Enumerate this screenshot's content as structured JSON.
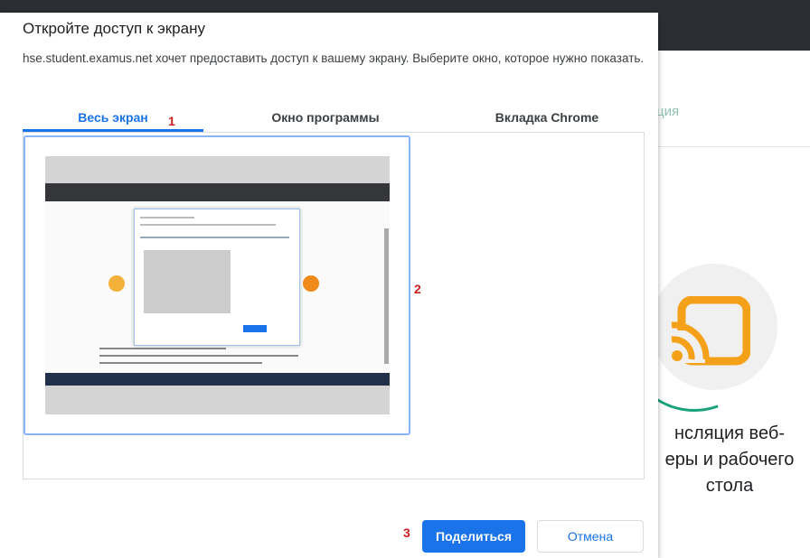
{
  "background": {
    "tab_text": "ция",
    "heading_lines": [
      "нсляция веб-",
      "еры и рабочего",
      "стола"
    ],
    "icon": "cast-icon",
    "accent": "#f4a019"
  },
  "dialog": {
    "title": "Откройте доступ к экрану",
    "description": "hse.student.examus.net хочет предоставить доступ к вашему экрану. Выберите окно, которое нужно показать.",
    "tabs": [
      {
        "label": "Весь экран",
        "active": true
      },
      {
        "label": "Окно программы",
        "active": false
      },
      {
        "label": "Вкладка Chrome",
        "active": false
      }
    ],
    "share_label": "Поделиться",
    "cancel_label": "Отмена",
    "accent": "#1a73e8"
  },
  "annotations": {
    "a1": "1",
    "a2": "2",
    "a3": "3",
    "color": "#cc1e1e"
  }
}
